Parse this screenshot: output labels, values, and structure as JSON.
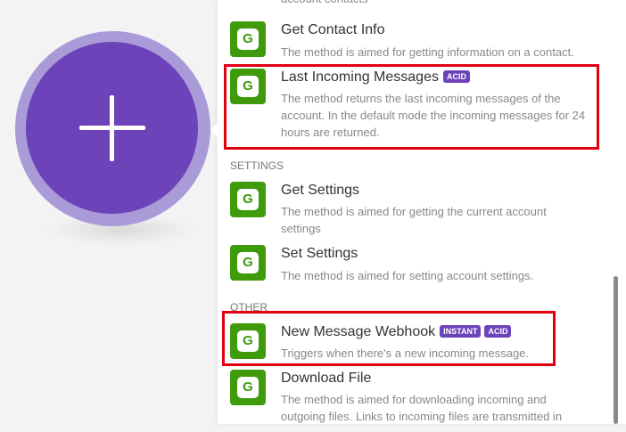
{
  "canvas": {
    "add_button_symbol": "+"
  },
  "modules": [
    {
      "id": "top-partial",
      "title": "",
      "desc": "account contacts",
      "badges": []
    },
    {
      "id": "get-contact-info",
      "title": "Get Contact Info",
      "desc": "The method is aimed for getting information on a contact.",
      "badges": []
    },
    {
      "id": "last-incoming-messages",
      "title": "Last Incoming Messages",
      "desc": "The method returns the last incoming messages of the account. In the default mode the incoming messages for 24 hours are returned.",
      "badges": [
        "ACID"
      ]
    },
    {
      "id": "get-settings",
      "title": "Get Settings",
      "desc": "The method is aimed for getting the current account settings",
      "badges": []
    },
    {
      "id": "set-settings",
      "title": "Set Settings",
      "desc": "The method is aimed for setting account settings.",
      "badges": []
    },
    {
      "id": "new-message-webhook",
      "title": "New Message Webhook",
      "desc": "Triggers when there's a new incoming message.",
      "badges": [
        "INSTANT",
        "ACID"
      ]
    },
    {
      "id": "download-file",
      "title": "Download File",
      "desc": "The method is aimed for downloading incoming and outgoing files. Links to incoming files are transmitted in",
      "badges": []
    }
  ],
  "sections": {
    "settings": "SETTINGS",
    "other": "OTHER"
  },
  "logo_letter": "G",
  "colors": {
    "accent": "#6c43b9",
    "app_green": "#3f9b0b",
    "highlight": "#e0000f"
  }
}
